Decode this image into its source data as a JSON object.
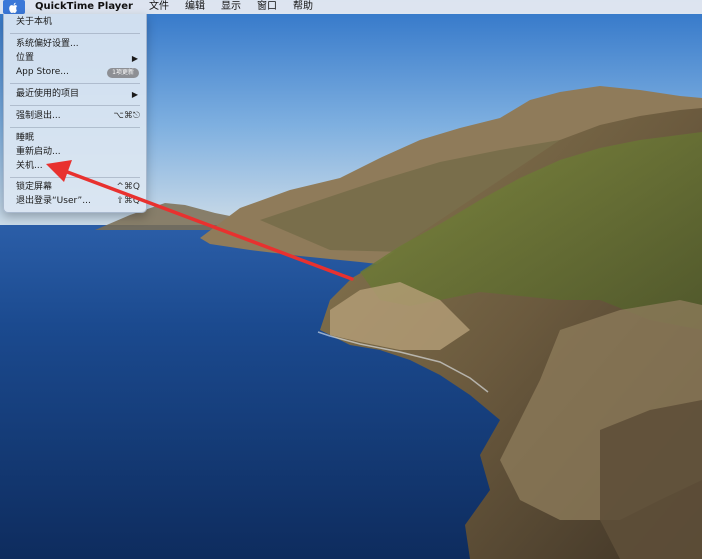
{
  "menubar": {
    "app_name": "QuickTime Player",
    "items": [
      "文件",
      "编辑",
      "显示",
      "窗口",
      "帮助"
    ]
  },
  "apple_menu": {
    "about": "关于本机",
    "system_prefs": "系统偏好设置...",
    "location": "位置",
    "app_store": "App Store...",
    "app_store_badge": "1项更新",
    "recent_items": "最近使用的项目",
    "force_quit": "强制退出...",
    "force_quit_shortcut": "⌥⌘⎋",
    "sleep": "睡眠",
    "restart": "重新启动...",
    "shutdown": "关机...",
    "lock_screen": "锁定屏幕",
    "lock_screen_shortcut": "^⌘Q",
    "logout": "退出登录“User”...",
    "logout_shortcut": "⇧⌘Q"
  },
  "colors": {
    "annotation_arrow": "#e8312f",
    "menu_highlight": "#3b78d8"
  },
  "icons": {
    "apple": "apple-icon",
    "submenu": "chevron-right-icon",
    "annotation": "red-arrow-icon"
  }
}
